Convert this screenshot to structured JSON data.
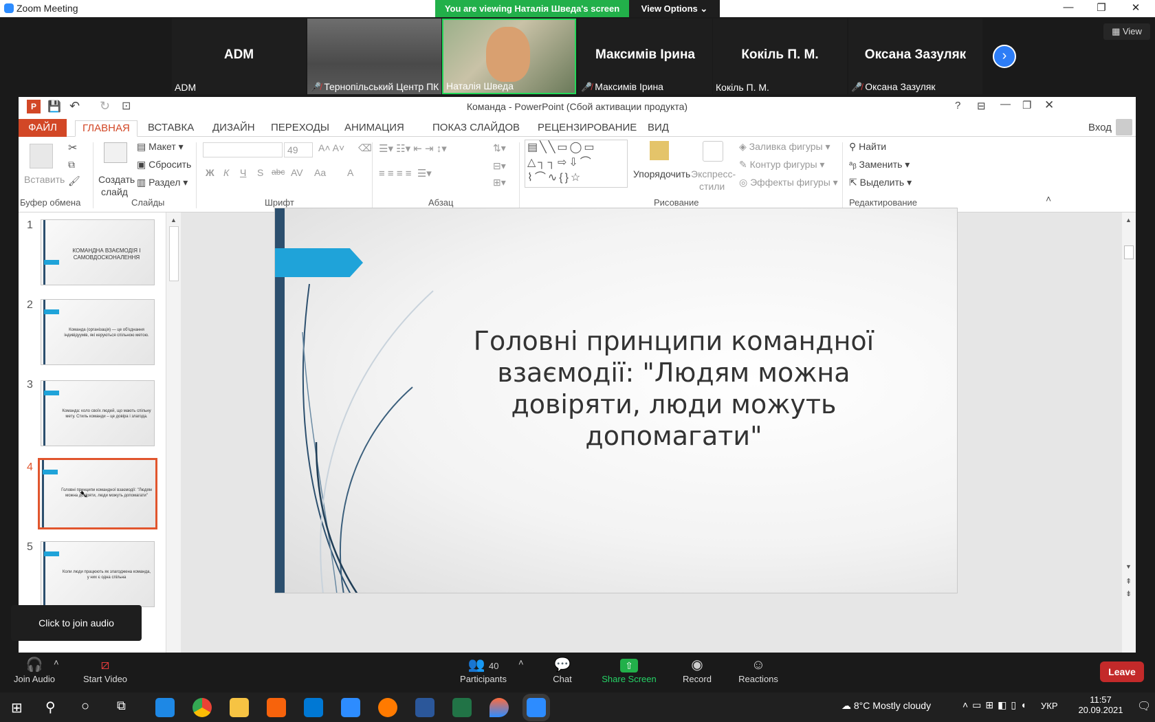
{
  "zoom": {
    "title": "Zoom Meeting",
    "banner": "You are viewing Наталія Шведа's screen",
    "view_options": "View Options",
    "view_button": "View",
    "participants": [
      {
        "name": "ADM",
        "label": "ADM",
        "muted": false,
        "video": false
      },
      {
        "name": "",
        "label": "Тернопільський Центр ПК",
        "muted": true,
        "video": true
      },
      {
        "name": "",
        "label": "Наталія Шведа",
        "muted": false,
        "video": true
      },
      {
        "name": "Максимів Ірина",
        "label": "Максимів Ірина",
        "muted": true,
        "video": false
      },
      {
        "name": "Кокіль П. М.",
        "label": "Кокіль П. М.",
        "muted": false,
        "video": false
      },
      {
        "name": "Оксана Зазуляк",
        "label": "Оксана Зазуляк",
        "muted": true,
        "video": false
      }
    ],
    "tooltip": "Click to join audio",
    "toolbar": {
      "join_audio": "Join Audio",
      "start_video": "Start Video",
      "participants": "Participants",
      "participants_count": "40",
      "chat": "Chat",
      "share_screen": "Share Screen",
      "record": "Record",
      "reactions": "Reactions",
      "leave": "Leave"
    }
  },
  "ppt": {
    "title": "Команда - PowerPoint (Сбой активации продукта)",
    "signin": "Вход",
    "tabs": [
      "ФАЙЛ",
      "ГЛАВНАЯ",
      "ВСТАВКА",
      "ДИЗАЙН",
      "ПЕРЕХОДЫ",
      "АНИМАЦИЯ",
      "ПОКАЗ СЛАЙДОВ",
      "РЕЦЕНЗИРОВАНИЕ",
      "ВИД"
    ],
    "ribbon": {
      "paste": "Вставить",
      "create_slide": "Создать",
      "create_slide2": "слайд",
      "layout": "Макет",
      "reset": "Сбросить",
      "section": "Раздел",
      "font_size": "49",
      "arrange": "Упорядочить",
      "express": "Экспресс-",
      "express2": "стили",
      "fill": "Заливка фигуры",
      "outline": "Контур фигуры",
      "effects": "Эффекты фигуры",
      "find": "Найти",
      "replace": "Заменить",
      "select": "Выделить",
      "groups": [
        "Буфер обмена",
        "Слайды",
        "Шрифт",
        "Абзац",
        "Рисование",
        "Редактирование"
      ],
      "font_btns": [
        "Ж",
        "К",
        "Ч",
        "S",
        "abc",
        "AV",
        "Aa",
        "A"
      ]
    },
    "thumbs": [
      {
        "num": "1",
        "text": "КОМАНДНА ВЗАЄМОДІЯ І САМОВДОСКОНАЛЕННЯ"
      },
      {
        "num": "2",
        "text": "Команда (організація) — це об'єднання індивідуумів, які керуються спільною метою."
      },
      {
        "num": "3",
        "text": "Команда: коло своїх людей, що мають спільну мету. Стиль команди – це довіра і злагода."
      },
      {
        "num": "4",
        "text": "Головні принципи командної взаємодії: \"Людям можна довіряти, люди можуть допомагати\""
      },
      {
        "num": "5",
        "text": "Коли люди працюють як злагоджена команда, у них є одна спільна"
      }
    ],
    "slide_title": "Головні принципи командної взаємодії: \"Людям можна довіряти, люди можуть допомагати\""
  },
  "taskbar": {
    "weather": "8°C  Mostly cloudy",
    "lang": "УКР",
    "time": "11:57",
    "date": "20.09.2021"
  }
}
